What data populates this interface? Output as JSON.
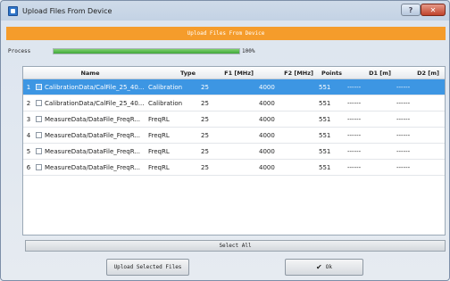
{
  "window": {
    "title": "Upload Files From Device",
    "help_glyph": "?",
    "close_glyph": "✕"
  },
  "banner": {
    "text": "Upload Files From Device"
  },
  "progress": {
    "label": "Process",
    "value": 1.0,
    "text": "100%"
  },
  "table": {
    "columns": [
      "",
      "Name",
      "Type",
      "F1 [MHz]",
      "F2 [MHz]",
      "Points",
      "D1 [m]",
      "D2 [m]"
    ],
    "rows": [
      {
        "num": "1",
        "name": "CalibrationData/CalFile_25_40...",
        "type": "Calibration",
        "f1": "25",
        "f2": "4000",
        "points": "551",
        "d1": "------",
        "d2": "------",
        "selected": true
      },
      {
        "num": "2",
        "name": "CalibrationData/CalFile_25_40...",
        "type": "Calibration",
        "f1": "25",
        "f2": "4000",
        "points": "551",
        "d1": "------",
        "d2": "------",
        "selected": false
      },
      {
        "num": "3",
        "name": "MeasureData/DataFile_FreqR...",
        "type": "FreqRL",
        "f1": "25",
        "f2": "4000",
        "points": "551",
        "d1": "------",
        "d2": "------",
        "selected": false
      },
      {
        "num": "4",
        "name": "MeasureData/DataFile_FreqR...",
        "type": "FreqRL",
        "f1": "25",
        "f2": "4000",
        "points": "551",
        "d1": "------",
        "d2": "------",
        "selected": false
      },
      {
        "num": "5",
        "name": "MeasureData/DataFile_FreqR...",
        "type": "FreqRL",
        "f1": "25",
        "f2": "4000",
        "points": "551",
        "d1": "------",
        "d2": "------",
        "selected": false
      },
      {
        "num": "6",
        "name": "MeasureData/DataFile_FreqR...",
        "type": "FreqRL",
        "f1": "25",
        "f2": "4000",
        "points": "551",
        "d1": "------",
        "d2": "------",
        "selected": false
      }
    ]
  },
  "select_all_label": "Select All",
  "buttons": {
    "upload_label": "Upload Selected Files",
    "ok_label": "Ok",
    "ok_icon": "✔"
  },
  "colors": {
    "banner": "#f59c2b",
    "selection": "#3d96e3",
    "progress": "#3fa73a"
  }
}
